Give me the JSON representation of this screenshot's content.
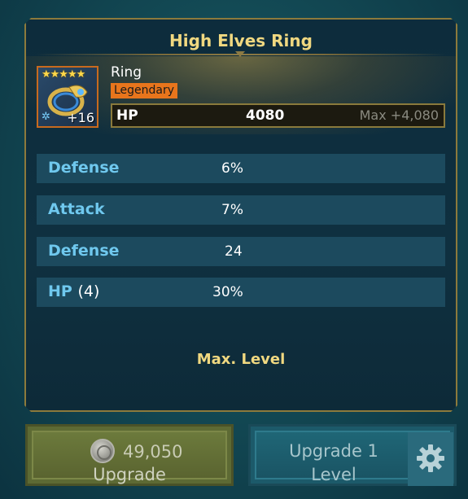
{
  "item": {
    "title": "High Elves Ring",
    "type": "Ring",
    "rarity": "Legendary",
    "stars": "★★★★★",
    "level": "+16",
    "set_icon": "✲",
    "icon": "ring-icon"
  },
  "main_stat": {
    "name": "HP",
    "value": "4080",
    "max": "Max +4,080"
  },
  "substats": [
    {
      "name": "Defense",
      "rolls": "",
      "value": "6%"
    },
    {
      "name": "Attack",
      "rolls": "",
      "value": "7%"
    },
    {
      "name": "Defense",
      "rolls": "",
      "value": "24"
    },
    {
      "name": "HP",
      "rolls": "(4)",
      "value": "30%"
    }
  ],
  "status": {
    "max_level": "Max. Level"
  },
  "buttons": {
    "upgrade_cost": "49,050",
    "upgrade_label": "Upgrade",
    "upgrade1_line1": "Upgrade 1",
    "upgrade1_line2": "Level",
    "coin_icon": "silver-coin-icon",
    "settings_icon": "gear-icon"
  },
  "colors": {
    "title_gold": "#f0d880",
    "rarity_orange": "#e8751c",
    "substat_blue": "#6fc8ee",
    "upgrade_button": "#5d6a34",
    "upgrade1_button": "#1c5a6a"
  }
}
